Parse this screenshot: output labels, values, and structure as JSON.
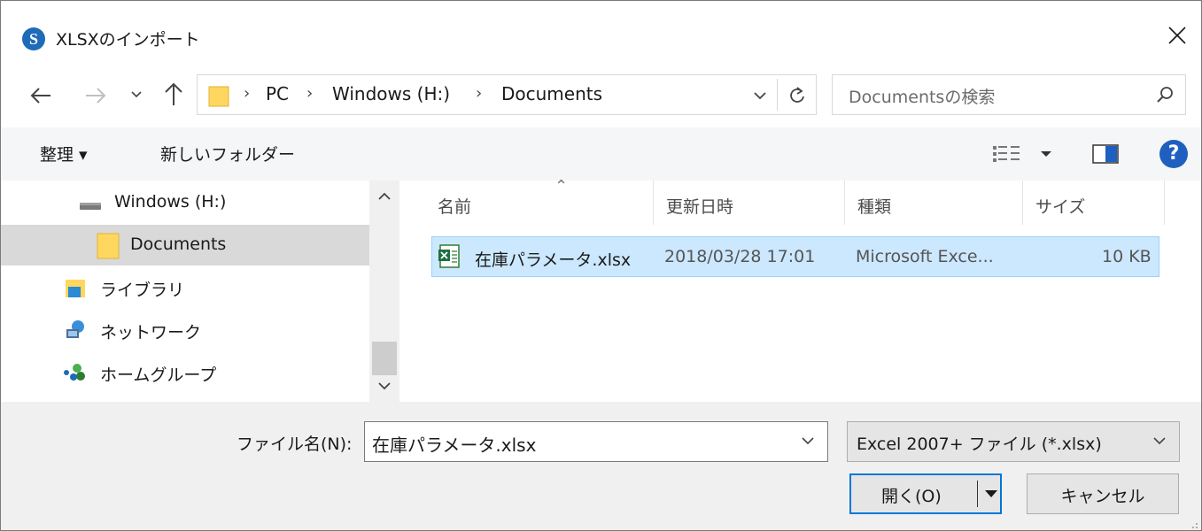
{
  "window": {
    "title": "XLSXのインポート",
    "app_icon_letter": "S",
    "app_icon_color": "#1e6bb8"
  },
  "address": {
    "crumbs": [
      "PC",
      "Windows (H:)",
      "Documents"
    ],
    "separator": "›"
  },
  "search": {
    "placeholder": "Documentsの検索"
  },
  "toolbar": {
    "organize_label": "整理 ▾",
    "new_folder_label": "新しいフォルダー",
    "help_label": "?"
  },
  "nav": {
    "items": [
      {
        "label": "Windows (H:)",
        "icon": "drive-icon",
        "selected": false
      },
      {
        "label": "Documents",
        "icon": "folder-icon",
        "selected": true
      },
      {
        "label": "ライブラリ",
        "icon": "library-icon",
        "selected": false
      },
      {
        "label": "ネットワーク",
        "icon": "network-icon",
        "selected": false
      },
      {
        "label": "ホームグループ",
        "icon": "homegroup-icon",
        "selected": false
      }
    ]
  },
  "columns": {
    "name": "名前",
    "modified": "更新日時",
    "type": "種類",
    "size": "サイズ"
  },
  "files": [
    {
      "name": "在庫パラメータ.xlsx",
      "modified": "2018/03/28 17:01",
      "type": "Microsoft Exce...",
      "size": "10 KB",
      "selected": true
    }
  ],
  "footer": {
    "filename_label": "ファイル名(N):",
    "filename_value": "在庫パラメータ.xlsx",
    "filetype_value": "Excel 2007+ ファイル (*.xlsx)",
    "open_label": "開く(O)",
    "cancel_label": "キャンセル"
  },
  "colors": {
    "selection_bg": "#cce8ff",
    "selection_border": "#99d1ff",
    "accent": "#0078d7",
    "help": "#1f5fbf"
  }
}
